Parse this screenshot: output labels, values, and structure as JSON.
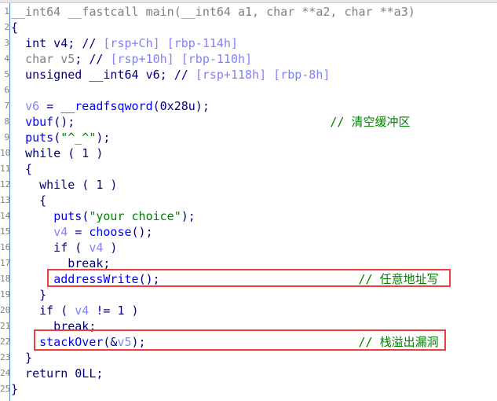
{
  "editor": {
    "colors": {
      "keyword": "#000080",
      "function": "#0000ff",
      "variable": "#8080ff",
      "unused": "#808080",
      "comment": "#008000",
      "highlight_box": "#f03c3c"
    },
    "lines": [
      {
        "n": "1",
        "tokens": [
          {
            "t": "__int64 __fastcall main(__int64 a1, char **a2, char **a3)",
            "c": "gray"
          }
        ]
      },
      {
        "n": "2",
        "tokens": [
          {
            "t": "{",
            "c": "kw"
          }
        ]
      },
      {
        "n": "3",
        "tokens": [
          {
            "t": "  int v4; ",
            "c": "kw"
          },
          {
            "t": "// ",
            "c": "kw"
          },
          {
            "t": "[rsp+Ch] [rbp-114h]",
            "c": "var"
          }
        ]
      },
      {
        "n": "4",
        "tokens": [
          {
            "t": "  char v5",
            "c": "gray"
          },
          {
            "t": "; // ",
            "c": "kw"
          },
          {
            "t": "[rsp+10h] [rbp-110h]",
            "c": "var"
          }
        ]
      },
      {
        "n": "5",
        "tokens": [
          {
            "t": "  unsigned __int64 v6; ",
            "c": "kw"
          },
          {
            "t": "// ",
            "c": "kw"
          },
          {
            "t": "[rsp+118h] [rbp-8h]",
            "c": "var"
          }
        ]
      },
      {
        "n": "6",
        "tokens": []
      },
      {
        "n": "7",
        "tokens": [
          {
            "t": "  ",
            "c": "kw"
          },
          {
            "t": "v6",
            "c": "var"
          },
          {
            "t": " = ",
            "c": "kw"
          },
          {
            "t": "__readfsqword",
            "c": "fn"
          },
          {
            "t": "(0x28u);",
            "c": "kw"
          }
        ]
      },
      {
        "n": "8",
        "tokens": [
          {
            "t": "  ",
            "c": "kw"
          },
          {
            "t": "vbuf",
            "c": "fn"
          },
          {
            "t": "();                                    ",
            "c": "kw"
          },
          {
            "t": "// 清空缓冲区",
            "c": "cm"
          }
        ]
      },
      {
        "n": "9",
        "tokens": [
          {
            "t": "  ",
            "c": "kw"
          },
          {
            "t": "puts",
            "c": "fn"
          },
          {
            "t": "(",
            "c": "kw"
          },
          {
            "t": "\"^_^\"",
            "c": "str"
          },
          {
            "t": ");",
            "c": "kw"
          }
        ]
      },
      {
        "n": "10",
        "tokens": [
          {
            "t": "  while ( 1 )",
            "c": "kw"
          }
        ]
      },
      {
        "n": "11",
        "tokens": [
          {
            "t": "  {",
            "c": "kw"
          }
        ]
      },
      {
        "n": "12",
        "tokens": [
          {
            "t": "    while ( 1 )",
            "c": "kw"
          }
        ]
      },
      {
        "n": "13",
        "tokens": [
          {
            "t": "    {",
            "c": "kw"
          }
        ]
      },
      {
        "n": "14",
        "tokens": [
          {
            "t": "      ",
            "c": "kw"
          },
          {
            "t": "puts",
            "c": "fn"
          },
          {
            "t": "(",
            "c": "kw"
          },
          {
            "t": "\"your choice\"",
            "c": "str"
          },
          {
            "t": ");",
            "c": "kw"
          }
        ]
      },
      {
        "n": "15",
        "tokens": [
          {
            "t": "      ",
            "c": "kw"
          },
          {
            "t": "v4",
            "c": "var"
          },
          {
            "t": " = ",
            "c": "kw"
          },
          {
            "t": "choose",
            "c": "fn"
          },
          {
            "t": "();",
            "c": "kw"
          }
        ]
      },
      {
        "n": "16",
        "tokens": [
          {
            "t": "      if ( ",
            "c": "kw"
          },
          {
            "t": "v4",
            "c": "var"
          },
          {
            "t": " )",
            "c": "kw"
          }
        ]
      },
      {
        "n": "17",
        "tokens": [
          {
            "t": "        break;",
            "c": "kw"
          }
        ]
      },
      {
        "n": "18",
        "tokens": [
          {
            "t": "      ",
            "c": "kw"
          },
          {
            "t": "addressWrite",
            "c": "fn"
          },
          {
            "t": "();                            ",
            "c": "kw"
          },
          {
            "t": "// 任意地址写",
            "c": "cm"
          }
        ]
      },
      {
        "n": "19",
        "tokens": [
          {
            "t": "    }",
            "c": "kw"
          }
        ]
      },
      {
        "n": "20",
        "tokens": [
          {
            "t": "    if ( ",
            "c": "kw"
          },
          {
            "t": "v4",
            "c": "var"
          },
          {
            "t": " != 1 )",
            "c": "kw"
          }
        ]
      },
      {
        "n": "21",
        "tokens": [
          {
            "t": "      break;",
            "c": "kw"
          }
        ]
      },
      {
        "n": "22",
        "tokens": [
          {
            "t": "    ",
            "c": "kw"
          },
          {
            "t": "stackOver",
            "c": "fn"
          },
          {
            "t": "(&",
            "c": "kw"
          },
          {
            "t": "v5",
            "c": "var"
          },
          {
            "t": ");                              ",
            "c": "kw"
          },
          {
            "t": "// 栈溢出漏洞",
            "c": "cm"
          }
        ]
      },
      {
        "n": "23",
        "tokens": [
          {
            "t": "  }",
            "c": "kw"
          }
        ]
      },
      {
        "n": "24",
        "tokens": [
          {
            "t": "  return 0LL;",
            "c": "kw"
          }
        ]
      },
      {
        "n": "25",
        "tokens": [
          {
            "t": "}",
            "c": "kw"
          }
        ]
      }
    ]
  }
}
